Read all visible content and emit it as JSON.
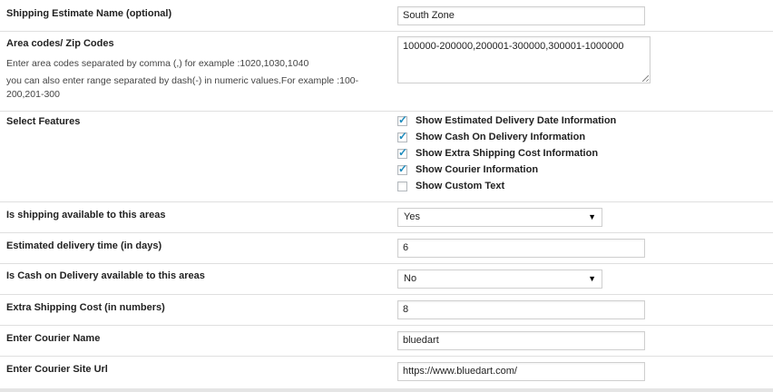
{
  "fields": {
    "estimate_name": {
      "label": "Shipping Estimate Name (optional)",
      "value": "South Zone"
    },
    "zip_codes": {
      "label": "Area codes/ Zip Codes",
      "help1": "Enter area codes separated by comma (,) for example :1020,1030,1040",
      "help2": "you can also enter range separated by dash(-) in numeric values.For example :100-",
      "help3": "200,201-300",
      "value": "100000-200000,200001-300000,300001-1000000"
    },
    "features": {
      "label": "Select Features",
      "options": [
        {
          "label": "Show Estimated Delivery Date Information",
          "checked": true
        },
        {
          "label": "Show Cash On Delivery Information",
          "checked": true
        },
        {
          "label": "Show Extra Shipping Cost Information",
          "checked": true
        },
        {
          "label": "Show Courier Information",
          "checked": true
        },
        {
          "label": "Show Custom Text",
          "checked": false
        }
      ]
    },
    "shipping_available": {
      "label": "Is shipping available to this areas",
      "value": "Yes"
    },
    "delivery_time": {
      "label": "Estimated delivery time (in days)",
      "value": "6"
    },
    "cod_available": {
      "label": "Is Cash on Delivery available to this areas",
      "value": "No"
    },
    "extra_cost": {
      "label": "Extra Shipping Cost (in numbers)",
      "value": "8"
    },
    "courier_name": {
      "label": "Enter Courier Name",
      "value": "bluedart"
    },
    "courier_url": {
      "label": "Enter Courier Site Url",
      "value": "https://www.bluedart.com/"
    }
  },
  "icons": {
    "checkbox_tick": "checkmark-icon",
    "select_arrow": "triangle-down-icon"
  },
  "colors": {
    "tick": "#1e8cbe",
    "border": "#dfdfdf"
  }
}
